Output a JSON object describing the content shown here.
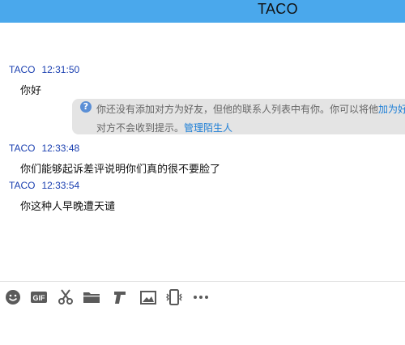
{
  "window": {
    "title": "TACO"
  },
  "messages": [
    {
      "sender": "TACO",
      "time": "12:31:50",
      "text": "你好"
    },
    {
      "sender": "TACO",
      "time": "12:33:48",
      "text": "你们能够起诉差评说明你们真的很不要脸了"
    },
    {
      "sender": "TACO",
      "time": "12:33:54",
      "text": "你这种人早晚遭天谴"
    }
  ],
  "notice": {
    "text1": "你还没有添加对方为好友，但他的联系人列表中有你。你可以将他",
    "link_add": "加为好友",
    "text2": "对方不会收到提示。",
    "link_manage": "管理陌生人"
  },
  "toolbar": {
    "icons": [
      "emoji-icon",
      "gif-icon",
      "scissors-icon",
      "folder-icon",
      "music-note-icon",
      "image-icon",
      "shake-phone-icon",
      "more-icon"
    ]
  }
}
